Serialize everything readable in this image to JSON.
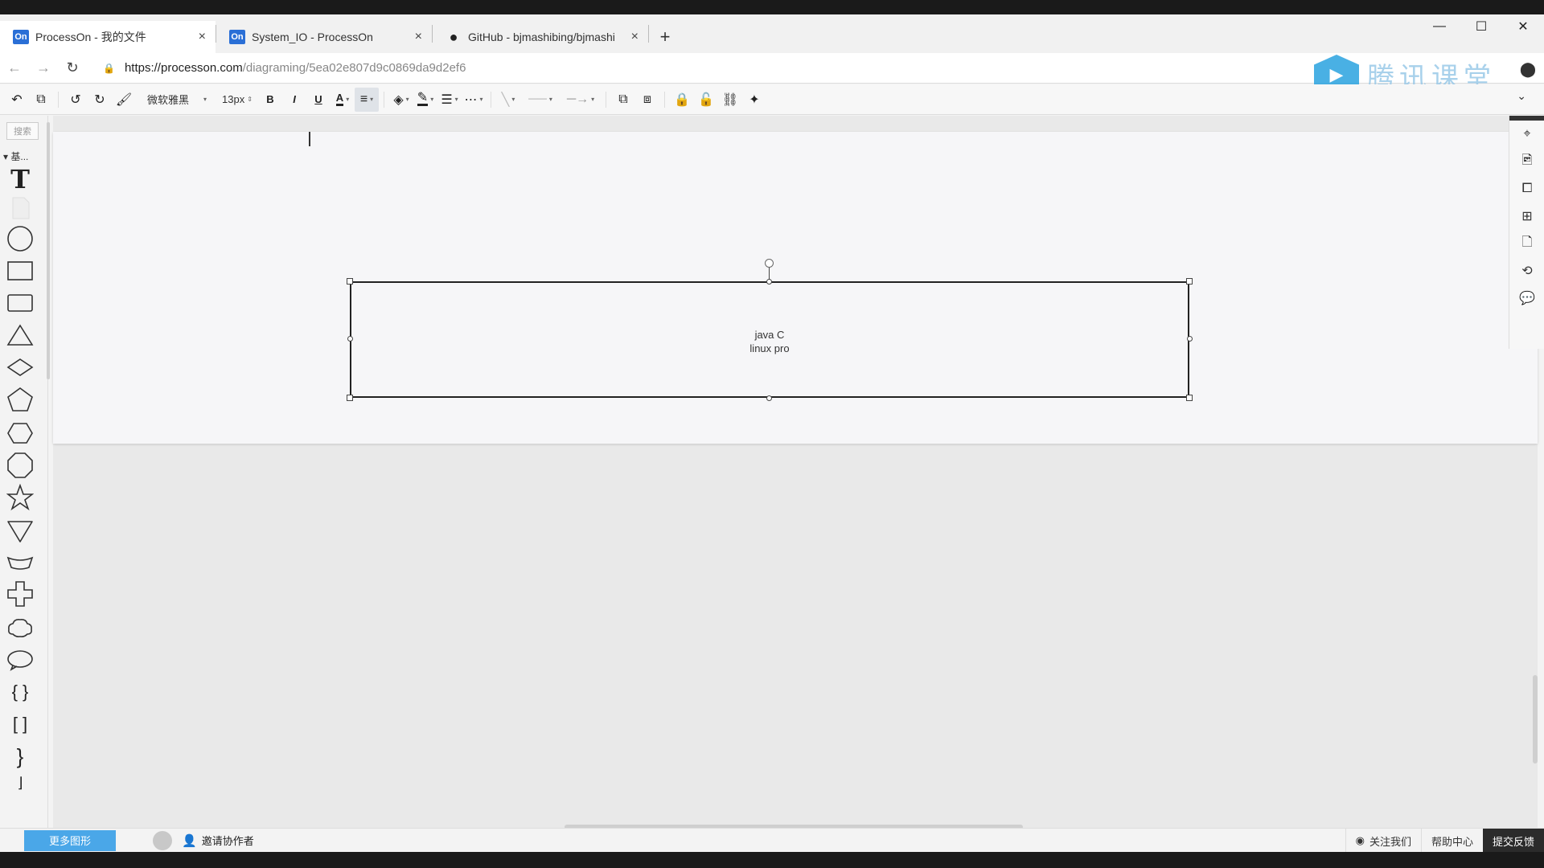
{
  "browser": {
    "tabs": [
      {
        "icon": "On",
        "title": "ProcessOn - 我的文件",
        "close": "×",
        "active": true
      },
      {
        "icon": "On",
        "title": "System_IO - ProcessOn",
        "close": "×",
        "active": false
      },
      {
        "icon": "github",
        "title": "GitHub - bjmashibing/bjmashi",
        "close": "×",
        "active": false
      }
    ],
    "new_tab": "+",
    "window_controls": [
      "—",
      "☐",
      "✕"
    ],
    "url_host": "https://processon.com",
    "url_path": "/diagraming/5ea02e807d9c0869da9d2ef6",
    "watermark_text": "腾讯课堂"
  },
  "toolbar": {
    "font_family": "微软雅黑",
    "font_size": "13px",
    "bold": "B",
    "italic": "I",
    "underline": "U",
    "text_color": "A"
  },
  "align_popup": {
    "horizontal": [
      "left-align-icon",
      "center-align-icon",
      "right-align-icon"
    ],
    "vertical": [
      "top-align-icon",
      "middle-align-icon",
      "bottom-align-icon"
    ]
  },
  "left_panel": {
    "search_placeholder": "搜索",
    "category": "基..."
  },
  "canvas": {
    "node_line1": "java  C",
    "node_line2": "linux  pro"
  },
  "footer": {
    "more_shapes": "更多图形",
    "invite": "邀请协作者",
    "follow_us": "关注我们",
    "help": "帮助中心",
    "feedback": "提交反馈"
  }
}
